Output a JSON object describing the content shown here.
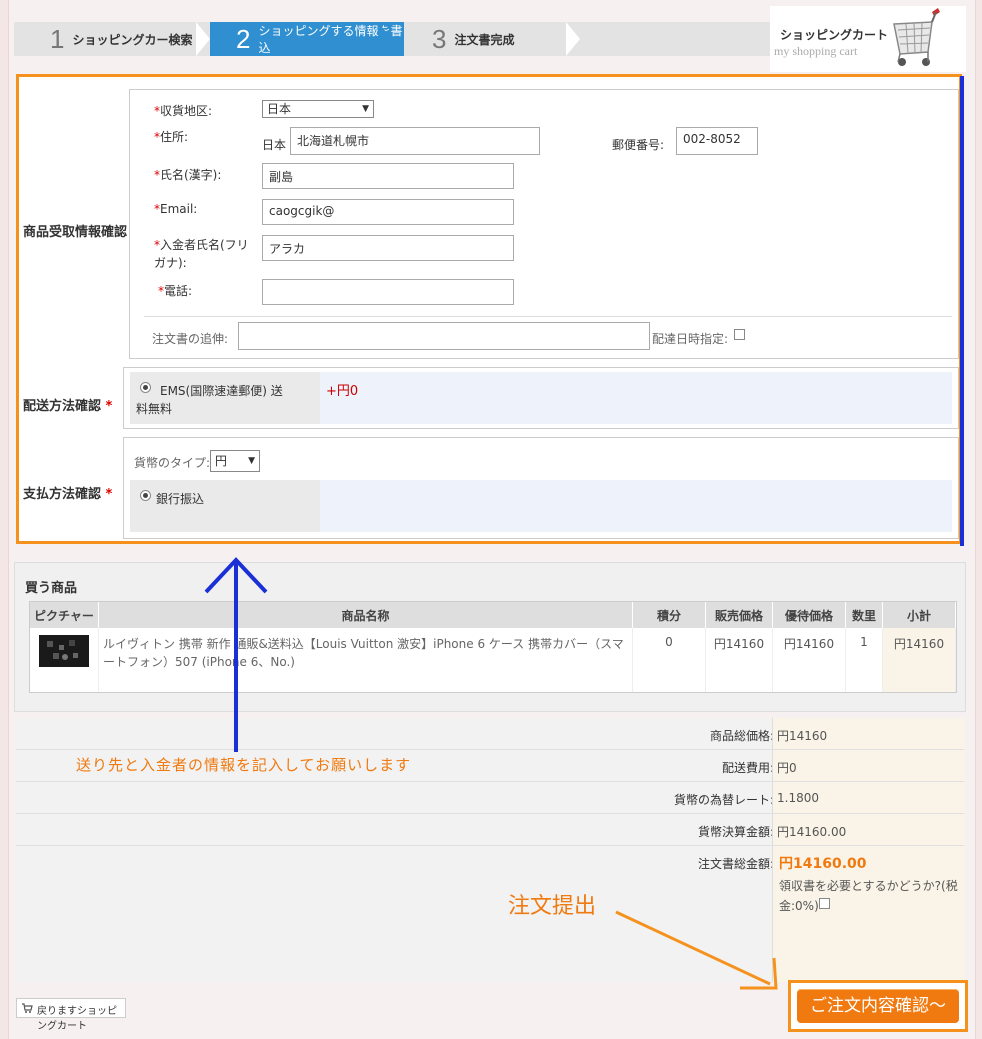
{
  "steps": [
    {
      "num": "1",
      "label": "ショッピングカー検索"
    },
    {
      "num": "2",
      "label": "ショッピングする情報を書込"
    },
    {
      "num": "3",
      "label": "注文書完成"
    }
  ],
  "cart": {
    "title": "ショッピングカート",
    "subtitle": "my shopping cart"
  },
  "receiver": {
    "section": "商品受取情報確認",
    "region_label": "収貨地区:",
    "region_value": "日本",
    "address_label": "住所:",
    "address_prefix": "日本",
    "address_value": "北海道札幌市",
    "postal_label": "郵便番号:",
    "postal_value": "002-8052",
    "name_label": "氏名(漢字):",
    "name_value": "副島",
    "email_label": "Email:",
    "email_value": "caogcgik@",
    "payer_label": "入金者氏名(フリガナ):",
    "payer_value": "アラカ",
    "phone_label": "電話:",
    "phone_value": "",
    "note_label": "注文書の追伸:",
    "note_value": "",
    "delivery_date_label": "配達日時指定:"
  },
  "shipping": {
    "section": "配送方法確認",
    "option": "EMS(国際速達郵便) 送料無料",
    "price": "+円0"
  },
  "payment": {
    "section": "支払方法確認",
    "currency_label": "貨幣のタイプ:",
    "currency_value": "円",
    "option": "銀行振込"
  },
  "products": {
    "title": "買う商品",
    "headers": [
      "ピクチャー",
      "商品名称",
      "積分",
      "販売価格",
      "優待価格",
      "数里",
      "小計"
    ],
    "rows": [
      {
        "name": "ルイヴィトン 携帯 新作 通販&送料込【Louis Vuitton 激安】iPhone 6 ケース 携帯カバー（スマートフォン）507 (iPhone 6、No.)",
        "points": "0",
        "price": "円14160",
        "discount_price": "円14160",
        "qty": "1",
        "subtotal": "円14160"
      }
    ]
  },
  "summary": {
    "goods_total_label": "商品総価格:",
    "goods_total": "円14160",
    "shipping_label": "配送費用:",
    "shipping": "円0",
    "rate_label": "貨幣の為替レート:",
    "rate": "1.1800",
    "settle_label": "貨幣決算金額:",
    "settle": "円14160.00",
    "grand_label": "注文書総金額:",
    "grand": "円14160.00",
    "receipt_note": "領収書を必要とするかどうか?(税金:",
    "receipt_pct": "0%)"
  },
  "annotations": {
    "fill_in": "送り先と入金者の情報を記入してお願いします",
    "submit_note": "注文提出"
  },
  "back_link": "戻りますショッピングカート",
  "submit_button": "ご注文内容確認～",
  "colors": {
    "accent": "#f07a10",
    "frame": "#f5921e",
    "blue": "#1a2fd6",
    "step_active": "#2f8fd0"
  }
}
